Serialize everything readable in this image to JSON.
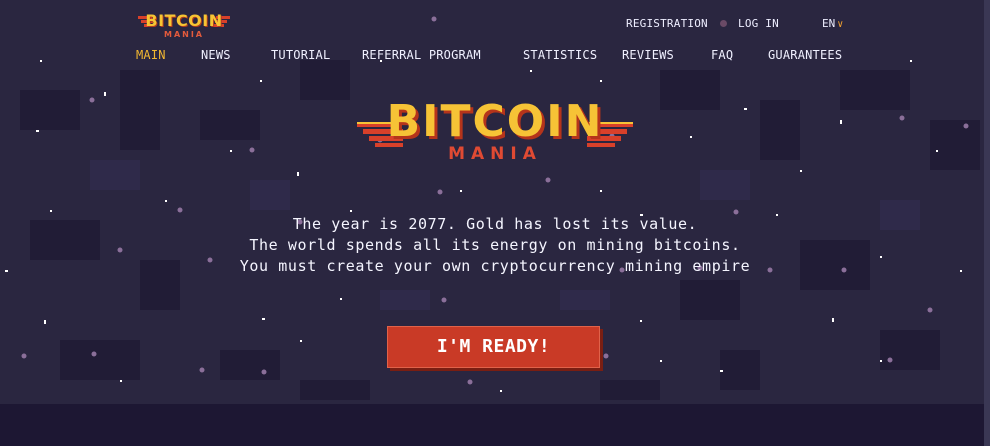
{
  "header": {
    "logo": {
      "line1": "BITCOIN",
      "line2": "MANIA"
    },
    "auth": {
      "register": "REGISTRATION",
      "login": "LOG IN"
    },
    "language": "EN",
    "colors": {
      "gold": "#f2b731",
      "red": "#c93a26",
      "background": "#2a2640"
    }
  },
  "nav": {
    "items": [
      {
        "label": "MAIN",
        "active": true
      },
      {
        "label": "NEWS"
      },
      {
        "label": "TUTORIAL"
      },
      {
        "label": "REFERRAL PROGRAM"
      },
      {
        "label": "STATISTICS"
      },
      {
        "label": "REVIEWS"
      },
      {
        "label": "FAQ"
      },
      {
        "label": "GUARANTEES"
      }
    ]
  },
  "hero": {
    "logo": {
      "line1": "BITCOIN",
      "line2": "MANIA"
    },
    "tagline": [
      "The year is 2077. Gold has lost its value.",
      "The world spends all its energy on mining bitcoins.",
      "You must create your own cryptocurrency mining empire"
    ],
    "cta_label": "I'M READY!"
  },
  "icons": {
    "language_dropdown": "chevron-down-icon",
    "login_marker": "dot-icon"
  }
}
